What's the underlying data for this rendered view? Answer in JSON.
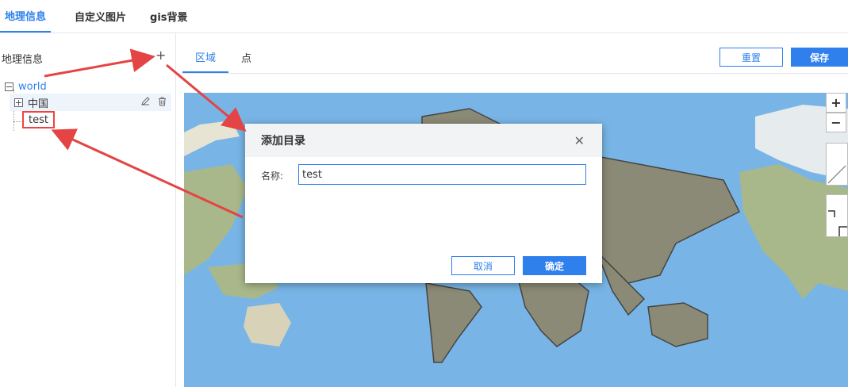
{
  "top_tabs": [
    {
      "label": "地理信息",
      "active": true
    },
    {
      "label": "自定义图片",
      "active": false
    },
    {
      "label": "gis背景",
      "active": false
    }
  ],
  "left_panel": {
    "title": "地理信息",
    "add_icon": "plus-icon",
    "tree": {
      "root": "world",
      "children": [
        {
          "label": "中国",
          "actions": [
            "edit-icon",
            "delete-icon"
          ]
        },
        {
          "label": "test"
        }
      ]
    }
  },
  "sub_tabs": [
    {
      "label": "区域",
      "active": true
    },
    {
      "label": "点",
      "active": false
    }
  ],
  "toolbar": {
    "reset_label": "重置",
    "save_label": "保存"
  },
  "map": {
    "zoom_in": "+",
    "zoom_out": "−"
  },
  "modal": {
    "title": "添加目录",
    "field_label": "名称:",
    "field_value": "test",
    "cancel_label": "取消",
    "ok_label": "确定"
  },
  "colors": {
    "accent": "#2f80ed",
    "annotation": "#e44444",
    "ocean": "#78b5e6"
  }
}
